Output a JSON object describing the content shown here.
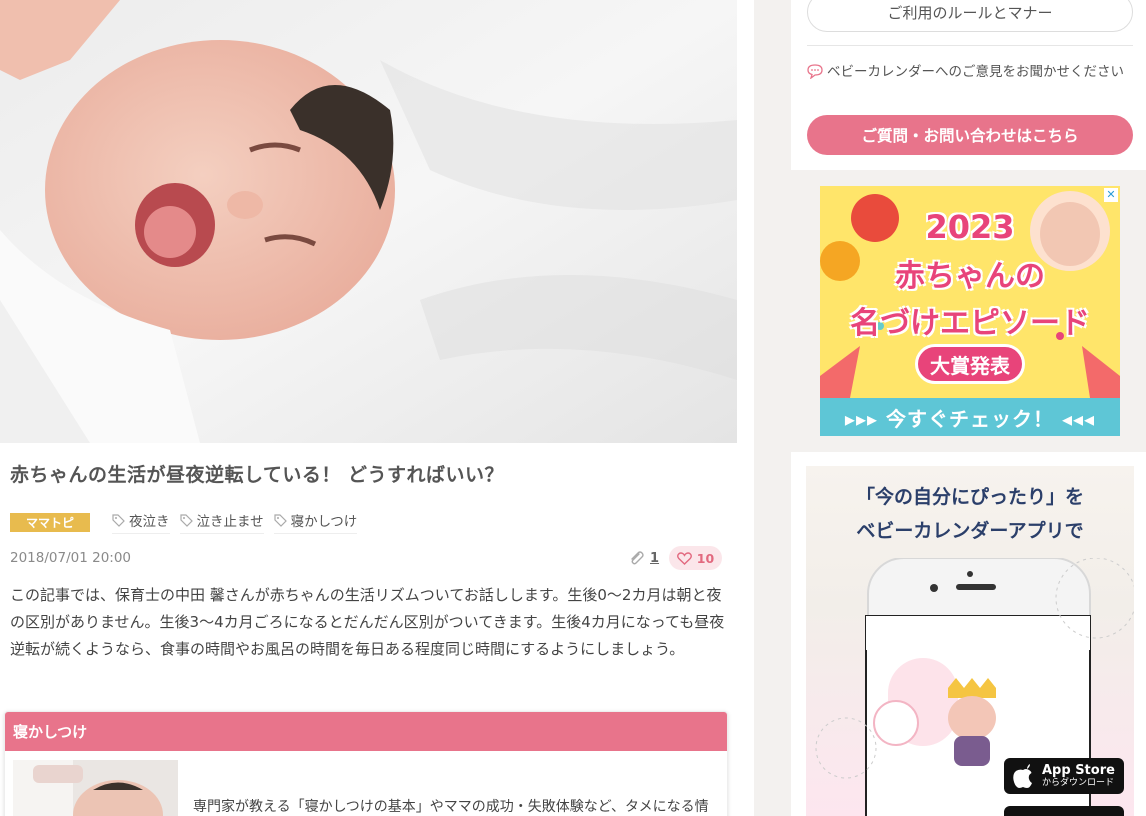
{
  "article": {
    "title": "赤ちゃんの生活が昼夜逆転している！ どうすればいい？",
    "category": "ママトピ",
    "tags": [
      "夜泣き",
      "泣き止ませ",
      "寝かしつけ"
    ],
    "date": "2018/07/01 20:00",
    "clip_count": "1",
    "like_count": "10",
    "description": "この記事では、保育士の中田 馨さんが赤ちゃんの生活リズムついてお話しします。生後0〜2カ月は朝と夜の区別がありません。生後3〜4カ月ごろになるとだんだん区別がついてきます。生後4カ月になっても昼夜逆転が続くようなら、食事の時間やお風呂の時間を毎日ある程度同じ時間にするようにしましょう。"
  },
  "related": {
    "heading": "寝かしつけ",
    "text": "専門家が教える「寝かしつけの基本」やママの成功・失敗体験など、タメになる情"
  },
  "sidebar": {
    "rules_button": "ご利用のルールとマナー",
    "feedback_text": "ベビーカレンダーへのご意見をお聞かせください",
    "contact_button": "ご質問・お問い合わせはこちら"
  },
  "ad1": {
    "close": "✕",
    "year": "2023",
    "line1": "赤ちゃんの",
    "line2": "名づけエピソード",
    "award": "大賞発表",
    "cta": "▸▸▸ 今すぐチェック！ ◂◂◂"
  },
  "ad2": {
    "line1": "「今の自分にぴったり」を",
    "line2": "ベビーカレンダーアプリで",
    "appstore_title": "App Store",
    "appstore_sub": "からダウンロード"
  },
  "colors": {
    "accent_pink": "#e8748b",
    "category_yellow": "#e8bb4e"
  }
}
